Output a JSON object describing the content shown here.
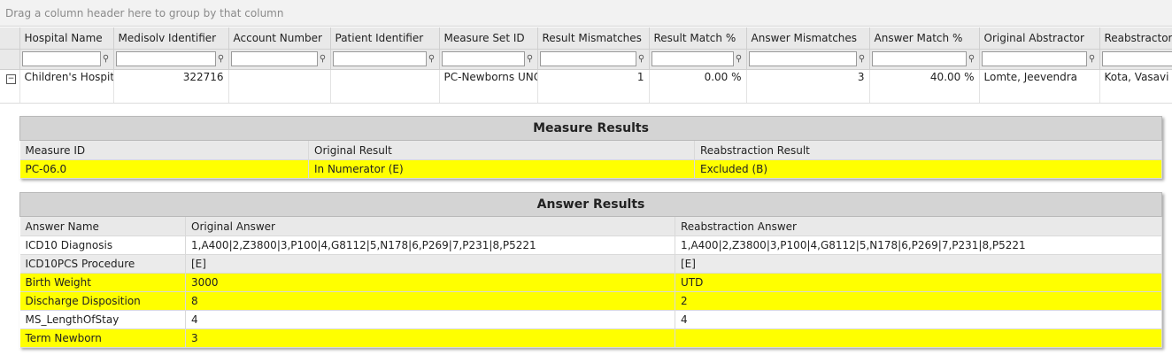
{
  "group_panel_text": "Drag a column header here to group by that column",
  "grid": {
    "columns": [
      "Hospital Name",
      "Medisolv Identifier",
      "Account Number",
      "Patient Identifier",
      "Measure Set ID",
      "Result Mismatches",
      "Result Match %",
      "Answer Mismatches",
      "Answer Match %",
      "Original Abstractor",
      "Reabstractor"
    ],
    "row": {
      "expand_icon": "minus-box-icon",
      "hospital_name": "Children's Hospital",
      "medisolv_identifier": "322716",
      "account_number": "",
      "patient_identifier": "",
      "measure_set_id": "PC-Newborns UNC",
      "result_mismatches": "1",
      "result_match_pct": "0.00 %",
      "answer_mismatches": "3",
      "answer_match_pct": "40.00 %",
      "original_abstractor": "Lomte, Jeevendra",
      "reabstractor": "Kota, Vasavi"
    }
  },
  "measure_results": {
    "title": "Measure Results",
    "headers": [
      "Measure ID",
      "Original Result",
      "Reabstraction Result"
    ],
    "rows": [
      {
        "measure_id": "PC-06.0",
        "original": "In Numerator (E)",
        "reabstraction": "Excluded (B)",
        "highlight": "#ffff00"
      }
    ]
  },
  "answer_results": {
    "title": "Answer Results",
    "headers": [
      "Answer Name",
      "Original Answer",
      "Reabstraction Answer"
    ],
    "rows": [
      {
        "name": "ICD10 Diagnosis",
        "original": "1,A400|2,Z3800|3,P100|4,G8112|5,N178|6,P269|7,P231|8,P5221",
        "reabstraction": "1,A400|2,Z3800|3,P100|4,G8112|5,N178|6,P269|7,P231|8,P5221"
      },
      {
        "name": "ICD10PCS Procedure",
        "original": "[E]",
        "reabstraction": "[E]"
      },
      {
        "name": "Birth Weight",
        "original": "3000",
        "reabstraction": "UTD"
      },
      {
        "name": "Discharge Disposition",
        "original": "8",
        "reabstraction": "2"
      },
      {
        "name": "MS_LengthOfStay",
        "original": "4",
        "reabstraction": "4"
      },
      {
        "name": "Term Newborn",
        "original": "3",
        "reabstraction": ""
      }
    ]
  },
  "colors": {
    "mismatch_highlight": "#ffff00",
    "header_bg": "#e9e9e9",
    "title_bg": "#d4d4d4"
  },
  "icons": {
    "filter": "filter-icon"
  }
}
